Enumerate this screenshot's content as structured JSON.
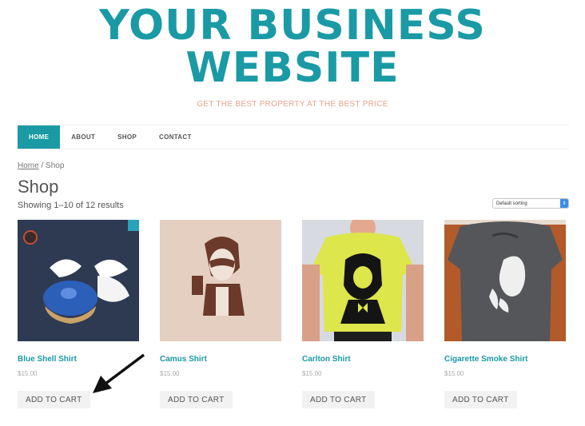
{
  "site": {
    "title_line1": "YOUR BUSINESS",
    "title_line2": "WEBSITE",
    "tagline": "GET THE BEST PROPERTY AT THE BEST PRICE"
  },
  "nav": {
    "items": [
      {
        "label": "HOME",
        "active": true
      },
      {
        "label": "ABOUT",
        "active": false
      },
      {
        "label": "SHOP",
        "active": false
      },
      {
        "label": "CONTACT",
        "active": false
      }
    ]
  },
  "breadcrumb": {
    "home": "Home",
    "separator": " / ",
    "current": "Shop"
  },
  "page": {
    "title": "Shop",
    "result_count": "Showing 1–10 of 12 results",
    "sorting_selected": "Default sorting"
  },
  "products": [
    {
      "name": "Blue Shell Shirt",
      "price": "$15.00",
      "button": "ADD TO CART"
    },
    {
      "name": "Camus Shirt",
      "price": "$15.00",
      "button": "ADD TO CART"
    },
    {
      "name": "Carlton Shirt",
      "price": "$15.00",
      "button": "ADD TO CART"
    },
    {
      "name": "Cigarette Smoke Shirt",
      "price": "$15.00",
      "button": "ADD TO CART"
    }
  ],
  "colors": {
    "brand": "#1a9aa5",
    "tagline": "#e8a48c",
    "price": "#aaaaaa"
  },
  "annotations": {
    "arrow": "black arrow pointing to first add-to-cart button"
  }
}
